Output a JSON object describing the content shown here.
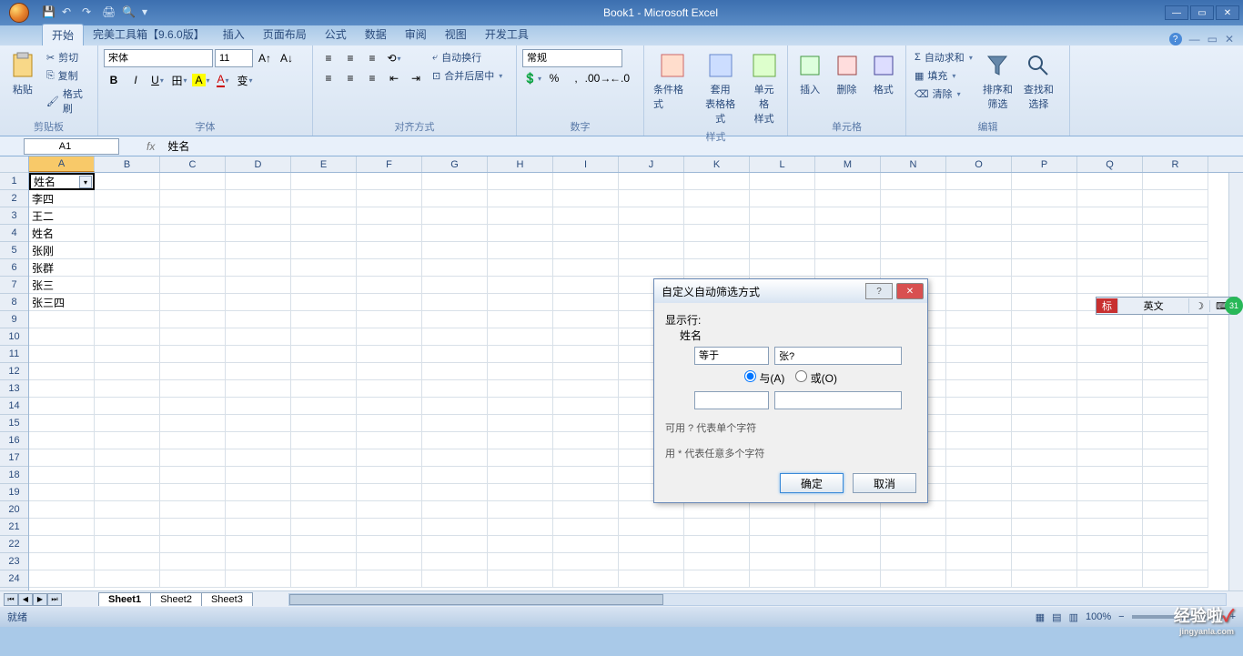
{
  "app_title": "Book1 - Microsoft Excel",
  "qat_icons": [
    "save",
    "undo",
    "redo",
    "print-preview",
    "quick-print",
    "new",
    "open"
  ],
  "tabs": {
    "items": [
      "开始",
      "完美工具箱【9.6.0版】",
      "插入",
      "页面布局",
      "公式",
      "数据",
      "审阅",
      "视图",
      "开发工具"
    ],
    "active": 0
  },
  "ribbon": {
    "clipboard": {
      "label": "剪贴板",
      "paste": "粘贴",
      "cut": "剪切",
      "copy": "复制",
      "format_painter": "格式刷"
    },
    "font": {
      "label": "字体",
      "name": "宋体",
      "size": "11"
    },
    "alignment": {
      "label": "对齐方式",
      "wrap": "自动换行",
      "merge": "合并后居中"
    },
    "number": {
      "label": "数字",
      "format": "常规"
    },
    "styles": {
      "label": "样式",
      "cond": "条件格式",
      "table": "套用\n表格格式",
      "cell": "单元格\n样式"
    },
    "cells": {
      "label": "单元格",
      "insert": "插入",
      "delete": "删除",
      "format": "格式"
    },
    "editing": {
      "label": "编辑",
      "sum": "自动求和",
      "fill": "填充",
      "clear": "清除",
      "sort": "排序和\n筛选",
      "find": "查找和\n选择"
    }
  },
  "name_box": "A1",
  "formula_value": "姓名",
  "columns": [
    "A",
    "B",
    "C",
    "D",
    "E",
    "F",
    "G",
    "H",
    "I",
    "J",
    "K",
    "L",
    "M",
    "N",
    "O",
    "P",
    "Q",
    "R"
  ],
  "rows": 24,
  "cell_data": [
    "姓名",
    "李四",
    "王二",
    "姓名",
    "张刚",
    "张群",
    "张三",
    "张三四"
  ],
  "selected_cell": "A1",
  "dialog": {
    "title": "自定义自动筛选方式",
    "show_rows": "显示行:",
    "field": "姓名",
    "op1": "等于",
    "val1": "张?",
    "and": "与(A)",
    "or": "或(O)",
    "op2": "",
    "val2": "",
    "hint1": "可用 ? 代表单个字符",
    "hint2": "用 * 代表任意多个字符",
    "ok": "确定",
    "cancel": "取消"
  },
  "sheets": {
    "items": [
      "Sheet1",
      "Sheet2",
      "Sheet3"
    ],
    "active": 0
  },
  "status": {
    "text": "就绪",
    "zoom": "100%"
  },
  "ime": {
    "lang": "英文",
    "badge": "31"
  },
  "watermark": {
    "main": "经验啦",
    "check": "✓",
    "sub": "jingyanla.com"
  }
}
